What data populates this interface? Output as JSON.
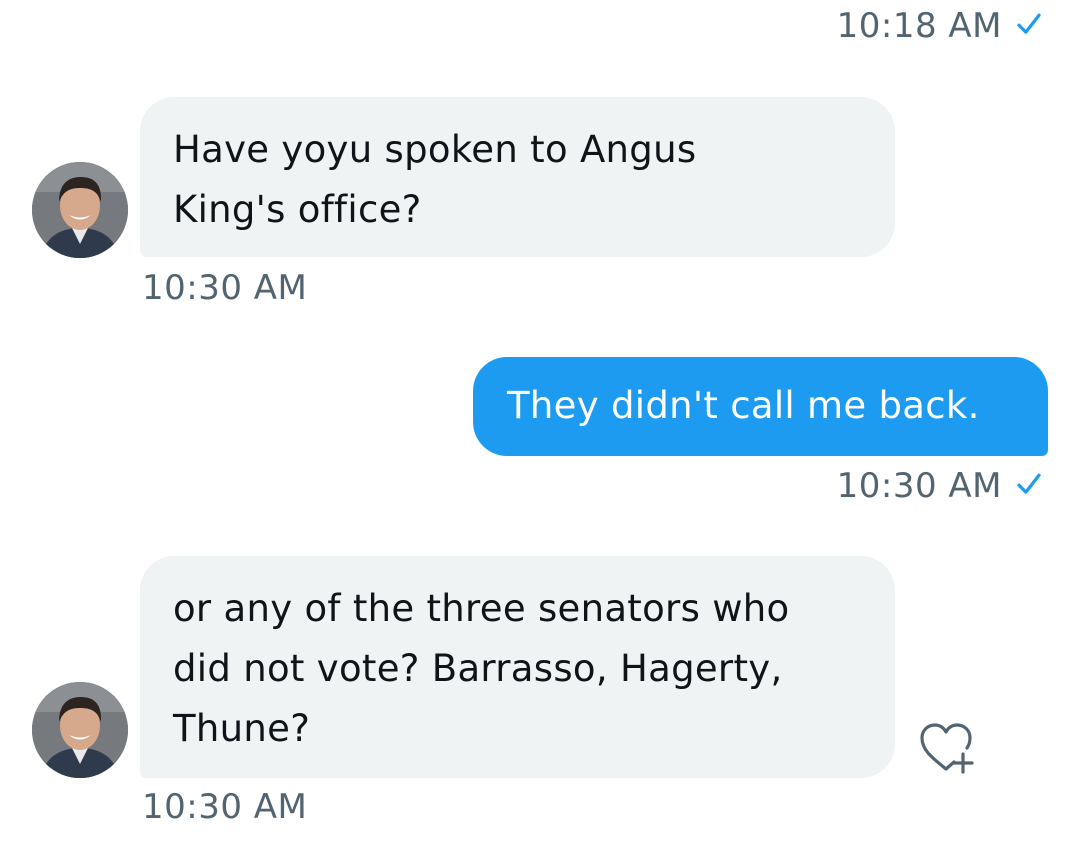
{
  "conversation": {
    "messages": [
      {
        "direction": "outgoing",
        "timestamp": "10:18 AM",
        "read_icon": "check-icon"
      },
      {
        "direction": "incoming",
        "avatar": "avatar",
        "text_lines": [
          "Have yoyu spoken to Angus",
          "King's office?"
        ],
        "timestamp": "10:30 AM"
      },
      {
        "direction": "outgoing",
        "text": "They didn't call me back.",
        "timestamp": "10:30 AM",
        "read_icon": "check-icon"
      },
      {
        "direction": "incoming",
        "avatar": "avatar",
        "text_lines": [
          "or any of the three senators who",
          "did not vote?  Barrasso, Hagerty,",
          "Thune?"
        ],
        "timestamp": "10:30 AM",
        "reaction_icon": "heart-plus-icon"
      }
    ]
  },
  "colors": {
    "outgoing_bubble": "#1d9bf0",
    "incoming_bubble": "#eff3f4",
    "timestamp_text": "#536471",
    "check": "#1d9bf0"
  }
}
